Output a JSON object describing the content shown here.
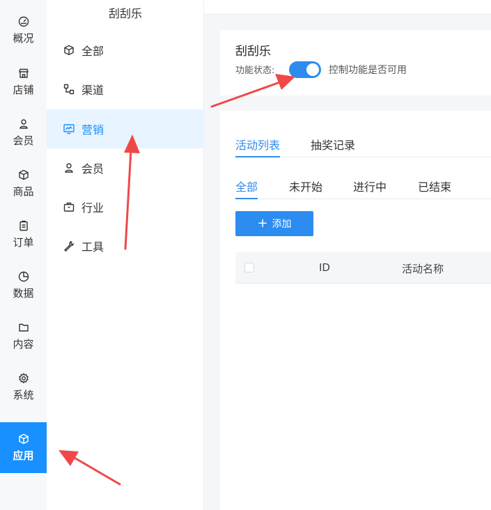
{
  "rail": {
    "items": [
      {
        "label": "概况",
        "icon": "dashboard-icon"
      },
      {
        "label": "店铺",
        "icon": "store-icon"
      },
      {
        "label": "会员",
        "icon": "user-icon"
      },
      {
        "label": "商品",
        "icon": "cube-icon"
      },
      {
        "label": "订单",
        "icon": "clipboard-icon"
      },
      {
        "label": "数据",
        "icon": "pie-chart-icon"
      },
      {
        "label": "内容",
        "icon": "folder-icon"
      },
      {
        "label": "系统",
        "icon": "gear-icon"
      },
      {
        "label": "应用",
        "icon": "cube-icon"
      }
    ],
    "active": "应用"
  },
  "sub_nav": {
    "title": "刮刮乐",
    "items": [
      {
        "label": "全部",
        "icon": "cube-icon"
      },
      {
        "label": "渠道",
        "icon": "channels-icon"
      },
      {
        "label": "营销",
        "icon": "monitor-chart-icon"
      },
      {
        "label": "会员",
        "icon": "user-icon"
      },
      {
        "label": "行业",
        "icon": "briefcase-icon"
      },
      {
        "label": "工具",
        "icon": "wrench-icon"
      }
    ],
    "active": "营销"
  },
  "feature": {
    "title": "刮刮乐",
    "status_label": "功能状态:",
    "enabled": true,
    "status_desc": "控制功能是否可用"
  },
  "tabs": {
    "items": [
      "活动列表",
      "抽奖记录"
    ],
    "active": "活动列表"
  },
  "status_filters": {
    "items": [
      "全部",
      "未开始",
      "进行中",
      "已结束"
    ],
    "active": "全部"
  },
  "actions": {
    "add_label": "添加"
  },
  "table": {
    "columns": [
      "ID",
      "活动名称"
    ]
  },
  "colors": {
    "primary": "#2d8cf0",
    "rail_active": "#1890ff",
    "annotation": "#f04848"
  }
}
